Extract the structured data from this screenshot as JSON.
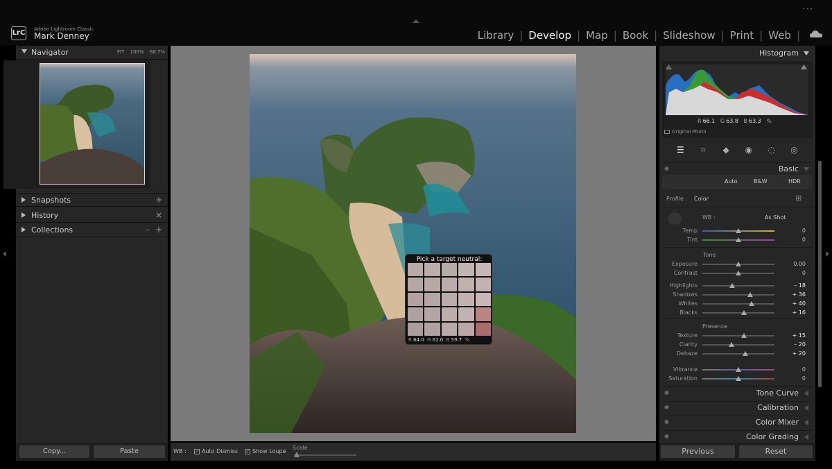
{
  "app": {
    "name": "Adobe Lightroom Classic",
    "logo": "LrC",
    "user": "Mark Denney"
  },
  "modules": [
    "Library",
    "Develop",
    "Map",
    "Book",
    "Slideshow",
    "Print",
    "Web"
  ],
  "active_module": "Develop",
  "left_panel": {
    "navigator": {
      "title": "Navigator",
      "options": [
        "FIT",
        "100%",
        "66.7%"
      ]
    },
    "snapshots": {
      "title": "Snapshots",
      "action": "+"
    },
    "history": {
      "title": "History",
      "action": "×"
    },
    "collections": {
      "title": "Collections",
      "actions": [
        "–",
        "+"
      ]
    },
    "copy_label": "Copy...",
    "paste_label": "Paste"
  },
  "loupe": {
    "title": "Pick a target neutral:",
    "r_label": "R",
    "r": "64.0",
    "g_label": "G",
    "g": "61.0",
    "b_label": "B",
    "b": "59.7",
    "unit": "%",
    "swatches": [
      "#b9aaa9",
      "#bcadaa",
      "#b8aaa6",
      "#c2b4b2",
      "#c6b6b5",
      "#b6a7a6",
      "#b8a8a6",
      "#bdadaa",
      "#c0b0ae",
      "#c4b3b2",
      "#b2a3a2",
      "#b5a5a4",
      "#bbabaa",
      "#c2b1b0",
      "#c8b7b6",
      "#b0a1a0",
      "#b5a6a5",
      "#bdaeac",
      "#c3b2b1",
      "#b98583",
      "#ab9d9c",
      "#b0a2a1",
      "#b9aaa9",
      "#bba7a6",
      "#a96c6c"
    ]
  },
  "toolbar": {
    "wb": "WB :",
    "auto_dismiss": "Auto Dismiss",
    "show_loupe": "Show Loupe",
    "scale": "Scale"
  },
  "histogram": {
    "title": "Histogram",
    "r_label": "R",
    "r": "66.1",
    "g_label": "G",
    "g": "63.8",
    "b_label": "B",
    "b": "63.3",
    "unit": "%",
    "original_photo": "Original Photo"
  },
  "basic": {
    "title": "Basic",
    "auto": "Auto",
    "bw": "B&W",
    "hdr": "HDR",
    "profile_label": "Profile :",
    "profile_value": "Color",
    "wb_label": "WB :",
    "wb_value": "As Shot",
    "temp": {
      "label": "Temp",
      "value": "0"
    },
    "tint": {
      "label": "Tint",
      "value": "0"
    },
    "tone_label": "Tone",
    "exposure": {
      "label": "Exposure",
      "value": "0.00"
    },
    "contrast": {
      "label": "Contrast",
      "value": "0"
    },
    "highlights": {
      "label": "Highlights",
      "value": "– 18"
    },
    "shadows": {
      "label": "Shadows",
      "value": "+ 36"
    },
    "whites": {
      "label": "Whites",
      "value": "+ 40"
    },
    "blacks": {
      "label": "Blacks",
      "value": "+ 16"
    },
    "presence_label": "Presence",
    "texture": {
      "label": "Texture",
      "value": "+ 15"
    },
    "clarity": {
      "label": "Clarity",
      "value": "– 20"
    },
    "dehaze": {
      "label": "Dehaze",
      "value": "+ 20"
    },
    "vibrance": {
      "label": "Vibrance",
      "value": "0"
    },
    "saturation": {
      "label": "Saturation",
      "value": "0"
    }
  },
  "collapsed_panels": [
    "Tone Curve",
    "Calibration",
    "Color Mixer",
    "Color Grading"
  ],
  "previous_label": "Previous",
  "reset_label": "Reset"
}
